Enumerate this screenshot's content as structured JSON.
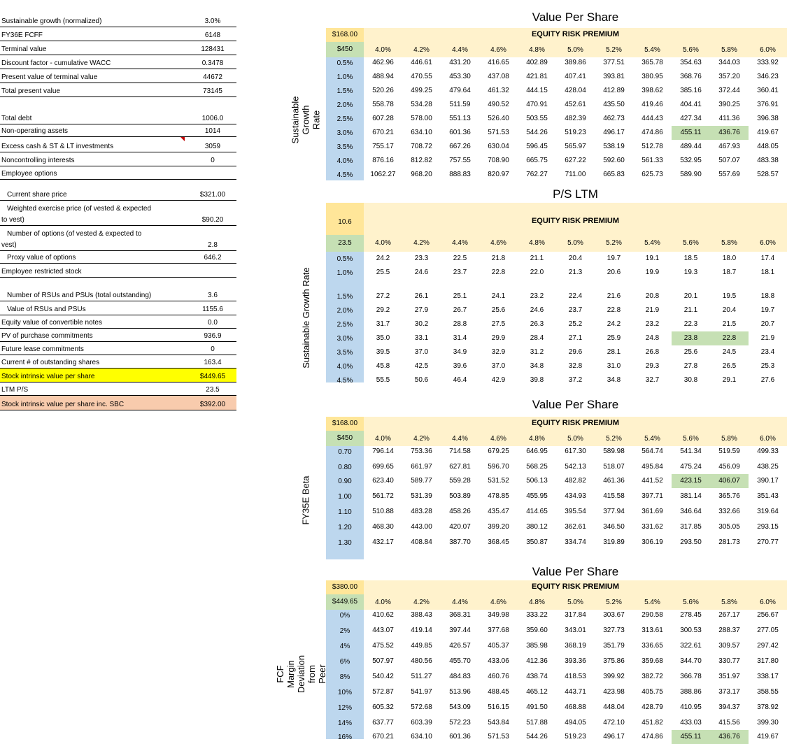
{
  "left": {
    "rows": [
      {
        "label": "Sustainable growth (normalized)",
        "value": "3.0%",
        "indent": false
      },
      {
        "label": "FY36E FCFF",
        "value": "6148",
        "indent": false
      },
      {
        "label": "Terminal value",
        "value": "128431",
        "indent": false
      },
      {
        "label": "Discount factor - cumulative WACC",
        "value": "0.3478",
        "indent": false
      },
      {
        "label": "Present value of terminal value",
        "value": "44672",
        "indent": false
      },
      {
        "label": "Total present value",
        "value": "73145",
        "indent": false
      },
      {
        "label": "",
        "value": "",
        "indent": false,
        "spacer": true
      },
      {
        "label": "Total debt",
        "value": "1006.0",
        "indent": false
      },
      {
        "label": "Non-operating assets",
        "value": "1014",
        "indent": false
      },
      {
        "label": "Excess cash & ST & LT investments",
        "value": "3059",
        "indent": false,
        "comment": true
      },
      {
        "label": "Noncontrolling interests",
        "value": "0",
        "indent": false
      },
      {
        "label": "Employee options",
        "value": "",
        "indent": false
      },
      {
        "label": "",
        "value": "",
        "indent": false,
        "spacer": true
      },
      {
        "label": "Current share price",
        "value": "$321.00",
        "indent": true
      },
      {
        "label": "Weighted exercise price (of vested & expected",
        "label2": "to vest)",
        "value": "$90.20",
        "indent": true,
        "double": true
      },
      {
        "label": "Number of options (of vested & expected to",
        "label2": "vest)",
        "value": "2.8",
        "indent": true,
        "double": true
      },
      {
        "label": "Proxy value of options",
        "value": "646.2",
        "indent": true
      },
      {
        "label": "Employee restricted stock",
        "value": "",
        "indent": false
      },
      {
        "label": "",
        "value": "",
        "indent": false,
        "spacer": true
      },
      {
        "label": "Number of RSUs and PSUs (total outstanding)",
        "value": "3.6",
        "indent": true
      },
      {
        "label": "Value of RSUs and PSUs",
        "value": "1155.6",
        "indent": true
      },
      {
        "label": "Equity value of convertible notes",
        "value": "0.0",
        "indent": false
      },
      {
        "label": "PV of purchase commitments",
        "value": "936.9",
        "indent": false
      },
      {
        "label": "Future lease commitments",
        "value": "0",
        "indent": false
      },
      {
        "label": "Current # of outstanding shares",
        "value": "163.4",
        "indent": false
      },
      {
        "label": "Stock intrinsic value per share",
        "value": "$449.65",
        "indent": false,
        "style": "yellow"
      },
      {
        "label": "LTM P/S",
        "value": "23.5",
        "indent": false
      },
      {
        "label": "Stock intrinsic value per share inc. SBC",
        "value": "$392.00",
        "indent": false,
        "style": "peach"
      }
    ]
  },
  "tables": [
    {
      "title": "Value Per Share",
      "ylabel": "Sustainable Growth Rate",
      "corner_top": "$168.00",
      "corner_bottom": "$450",
      "col_header": "EQUITY RISK PREMIUM",
      "columns": [
        "4.0%",
        "4.2%",
        "4.4%",
        "4.6%",
        "4.8%",
        "5.0%",
        "5.2%",
        "5.4%",
        "5.6%",
        "5.8%",
        "6.0%"
      ],
      "rows": [
        {
          "label": "0.5%",
          "values": [
            "462.96",
            "446.61",
            "431.20",
            "416.65",
            "402.89",
            "389.86",
            "377.51",
            "365.78",
            "354.63",
            "344.03",
            "333.92"
          ]
        },
        {
          "label": "1.0%",
          "values": [
            "488.94",
            "470.55",
            "453.30",
            "437.08",
            "421.81",
            "407.41",
            "393.81",
            "380.95",
            "368.76",
            "357.20",
            "346.23"
          ]
        },
        {
          "label": "1.5%",
          "values": [
            "520.26",
            "499.25",
            "479.64",
            "461.32",
            "444.15",
            "428.04",
            "412.89",
            "398.62",
            "385.16",
            "372.44",
            "360.41"
          ]
        },
        {
          "label": "2.0%",
          "values": [
            "558.78",
            "534.28",
            "511.59",
            "490.52",
            "470.91",
            "452.61",
            "435.50",
            "419.46",
            "404.41",
            "390.25",
            "376.91"
          ]
        },
        {
          "label": "2.5%",
          "values": [
            "607.28",
            "578.00",
            "551.13",
            "526.40",
            "503.55",
            "482.39",
            "462.73",
            "444.43",
            "427.34",
            "411.36",
            "396.38"
          ]
        },
        {
          "label": "3.0%",
          "values": [
            "670.21",
            "634.10",
            "601.36",
            "571.53",
            "544.26",
            "519.23",
            "496.17",
            "474.86",
            "455.11",
            "436.76",
            "419.67"
          ]
        },
        {
          "label": "3.5%",
          "values": [
            "755.17",
            "708.72",
            "667.26",
            "630.04",
            "596.45",
            "565.97",
            "538.19",
            "512.78",
            "489.44",
            "467.93",
            "448.05"
          ]
        },
        {
          "label": "4.0%",
          "values": [
            "876.16",
            "812.82",
            "757.55",
            "708.90",
            "665.75",
            "627.22",
            "592.60",
            "561.33",
            "532.95",
            "507.07",
            "483.38"
          ]
        },
        {
          "label": "4.5%",
          "values": [
            "1062.27",
            "968.20",
            "888.83",
            "820.97",
            "762.27",
            "711.00",
            "665.83",
            "625.73",
            "589.90",
            "557.69",
            "528.57"
          ]
        }
      ]
    },
    {
      "title": "P/S LTM",
      "ylabel": "Sustainable Growth Rate",
      "corner_top": "10.6",
      "corner_bottom": "23.5",
      "col_header": "EQUITY RISK PREMIUM",
      "columns": [
        "4.0%",
        "4.2%",
        "4.4%",
        "4.6%",
        "4.8%",
        "5.0%",
        "5.2%",
        "5.4%",
        "5.6%",
        "5.8%",
        "6.0%"
      ],
      "rows": [
        {
          "label": "0.5%",
          "values": [
            "24.2",
            "23.3",
            "22.5",
            "21.8",
            "21.1",
            "20.4",
            "19.7",
            "19.1",
            "18.5",
            "18.0",
            "17.4"
          ]
        },
        {
          "label": "1.0%",
          "values": [
            "25.5",
            "24.6",
            "23.7",
            "22.8",
            "22.0",
            "21.3",
            "20.6",
            "19.9",
            "19.3",
            "18.7",
            "18.1"
          ]
        },
        {
          "label": "1.5%",
          "values": [
            "27.2",
            "26.1",
            "25.1",
            "24.1",
            "23.2",
            "22.4",
            "21.6",
            "20.8",
            "20.1",
            "19.5",
            "18.8"
          ]
        },
        {
          "label": "2.0%",
          "values": [
            "29.2",
            "27.9",
            "26.7",
            "25.6",
            "24.6",
            "23.7",
            "22.8",
            "21.9",
            "21.1",
            "20.4",
            "19.7"
          ]
        },
        {
          "label": "2.5%",
          "values": [
            "31.7",
            "30.2",
            "28.8",
            "27.5",
            "26.3",
            "25.2",
            "24.2",
            "23.2",
            "22.3",
            "21.5",
            "20.7"
          ]
        },
        {
          "label": "3.0%",
          "values": [
            "35.0",
            "33.1",
            "31.4",
            "29.9",
            "28.4",
            "27.1",
            "25.9",
            "24.8",
            "23.8",
            "22.8",
            "21.9"
          ]
        },
        {
          "label": "3.5%",
          "values": [
            "39.5",
            "37.0",
            "34.9",
            "32.9",
            "31.2",
            "29.6",
            "28.1",
            "26.8",
            "25.6",
            "24.5",
            "23.4"
          ]
        },
        {
          "label": "4.0%",
          "values": [
            "45.8",
            "42.5",
            "39.6",
            "37.0",
            "34.8",
            "32.8",
            "31.0",
            "29.3",
            "27.8",
            "26.5",
            "25.3"
          ]
        },
        {
          "label": "4.5%",
          "values": [
            "55.5",
            "50.6",
            "46.4",
            "42.9",
            "39.8",
            "37.2",
            "34.8",
            "32.7",
            "30.8",
            "29.1",
            "27.6"
          ]
        }
      ]
    },
    {
      "title": "Value Per Share",
      "ylabel": "FY35E Beta",
      "corner_top": "$168.00",
      "corner_bottom": "$450",
      "col_header": "EQUITY RISK PREMIUM",
      "columns": [
        "4.0%",
        "4.2%",
        "4.4%",
        "4.6%",
        "4.8%",
        "5.0%",
        "5.2%",
        "5.4%",
        "5.6%",
        "5.8%",
        "6.0%"
      ],
      "rows": [
        {
          "label": "0.70",
          "values": [
            "796.14",
            "753.36",
            "714.58",
            "679.25",
            "646.95",
            "617.30",
            "589.98",
            "564.74",
            "541.34",
            "519.59",
            "499.33"
          ]
        },
        {
          "label": "0.80",
          "values": [
            "699.65",
            "661.97",
            "627.81",
            "596.70",
            "568.25",
            "542.13",
            "518.07",
            "495.84",
            "475.24",
            "456.09",
            "438.25"
          ]
        },
        {
          "label": "0.90",
          "values": [
            "623.40",
            "589.77",
            "559.28",
            "531.52",
            "506.13",
            "482.82",
            "461.36",
            "441.52",
            "423.15",
            "406.07",
            "390.17"
          ]
        },
        {
          "label": "1.00",
          "values": [
            "561.72",
            "531.39",
            "503.89",
            "478.85",
            "455.95",
            "434.93",
            "415.58",
            "397.71",
            "381.14",
            "365.76",
            "351.43"
          ]
        },
        {
          "label": "1.10",
          "values": [
            "510.88",
            "483.28",
            "458.26",
            "435.47",
            "414.65",
            "395.54",
            "377.94",
            "361.69",
            "346.64",
            "332.66",
            "319.64"
          ]
        },
        {
          "label": "1.20",
          "values": [
            "468.30",
            "443.00",
            "420.07",
            "399.20",
            "380.12",
            "362.61",
            "346.50",
            "331.62",
            "317.85",
            "305.05",
            "293.15"
          ]
        },
        {
          "label": "1.30",
          "values": [
            "432.17",
            "408.84",
            "387.70",
            "368.45",
            "350.87",
            "334.74",
            "319.89",
            "306.19",
            "293.50",
            "281.73",
            "270.77"
          ]
        }
      ]
    },
    {
      "title": "Value Per Share",
      "ylabel": "FCF Margin Deviation from Peer Group",
      "corner_top": "$380.00",
      "corner_bottom": "$449.65",
      "col_header": "EQUITY RISK PREMIUM",
      "columns": [
        "4.0%",
        "4.2%",
        "4.4%",
        "4.6%",
        "4.8%",
        "5.0%",
        "5.2%",
        "5.4%",
        "5.6%",
        "5.8%",
        "6.0%"
      ],
      "rows": [
        {
          "label": "0%",
          "values": [
            "410.62",
            "388.43",
            "368.31",
            "349.98",
            "333.22",
            "317.84",
            "303.67",
            "290.58",
            "278.45",
            "267.17",
            "256.67"
          ]
        },
        {
          "label": "2%",
          "values": [
            "443.07",
            "419.14",
            "397.44",
            "377.68",
            "359.60",
            "343.01",
            "327.73",
            "313.61",
            "300.53",
            "288.37",
            "277.05"
          ]
        },
        {
          "label": "4%",
          "values": [
            "475.52",
            "449.85",
            "426.57",
            "405.37",
            "385.98",
            "368.19",
            "351.79",
            "336.65",
            "322.61",
            "309.57",
            "297.42"
          ]
        },
        {
          "label": "6%",
          "values": [
            "507.97",
            "480.56",
            "455.70",
            "433.06",
            "412.36",
            "393.36",
            "375.86",
            "359.68",
            "344.70",
            "330.77",
            "317.80"
          ]
        },
        {
          "label": "8%",
          "values": [
            "540.42",
            "511.27",
            "484.83",
            "460.76",
            "438.74",
            "418.53",
            "399.92",
            "382.72",
            "366.78",
            "351.97",
            "338.17"
          ]
        },
        {
          "label": "10%",
          "values": [
            "572.87",
            "541.97",
            "513.96",
            "488.45",
            "465.12",
            "443.71",
            "423.98",
            "405.75",
            "388.86",
            "373.17",
            "358.55"
          ]
        },
        {
          "label": "12%",
          "values": [
            "605.32",
            "572.68",
            "543.09",
            "516.15",
            "491.50",
            "468.88",
            "448.04",
            "428.79",
            "410.95",
            "394.37",
            "378.92"
          ]
        },
        {
          "label": "14%",
          "values": [
            "637.77",
            "603.39",
            "572.23",
            "543.84",
            "517.88",
            "494.05",
            "472.10",
            "451.82",
            "433.03",
            "415.56",
            "399.30"
          ]
        },
        {
          "label": "16%",
          "values": [
            "670.21",
            "634.10",
            "601.36",
            "571.53",
            "544.26",
            "519.23",
            "496.17",
            "474.86",
            "455.11",
            "436.76",
            "419.67"
          ]
        }
      ]
    }
  ],
  "colors": {
    "corner_top": "#ffe699",
    "corner_bottom": "#c6e0b4",
    "header_band": "#fff2cc",
    "row_band": "#bdd7ee",
    "highlight": "#c6e0b4",
    "yellow": "#ffff00",
    "peach": "#f8cbad"
  }
}
